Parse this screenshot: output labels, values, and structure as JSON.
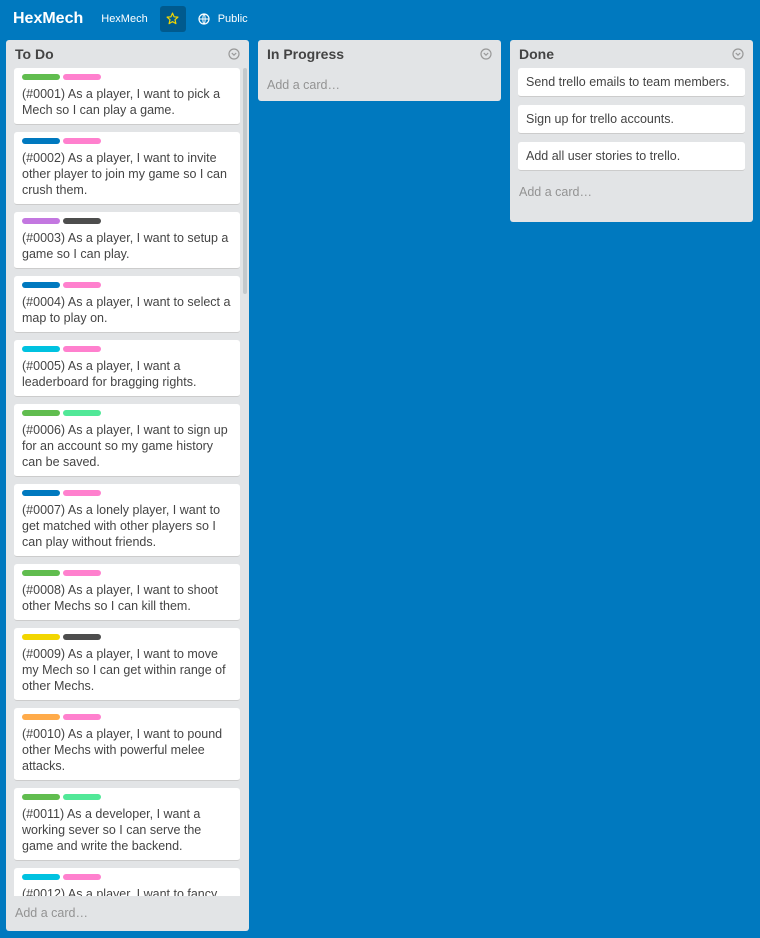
{
  "header": {
    "board_title": "HexMech",
    "org_name": "HexMech",
    "visibility": "Public",
    "icons": [
      "star-icon",
      "globe-icon"
    ]
  },
  "colors": {
    "background": "#0079bf",
    "list_bg": "#e2e4e6",
    "green": "#61bd4f",
    "pink": "#ff80ce",
    "blue": "#0079bf",
    "purple": "#c377e0",
    "black": "#4d4d4d",
    "sky": "#00c2e0",
    "lime": "#51e898",
    "yellow": "#f2d600",
    "orange": "#ffab4a"
  },
  "lists": {
    "todo": {
      "title": "To Do",
      "add_card": "Add a card…",
      "cards": [
        {
          "text": "(#0001) As a player, I want to pick a Mech so I can play a game.",
          "labels": [
            "green",
            "pink"
          ]
        },
        {
          "text": "(#0002) As a player, I want to invite other player to join my game so I can crush them.",
          "labels": [
            "blue",
            "pink"
          ]
        },
        {
          "text": "(#0003) As a player, I want to setup a game so I can play.",
          "labels": [
            "purple",
            "black"
          ]
        },
        {
          "text": "(#0004) As a player, I want to select a map to play on.",
          "labels": [
            "blue",
            "pink"
          ]
        },
        {
          "text": "(#0005) As a player, I want a leaderboard for bragging rights.",
          "labels": [
            "sky",
            "pink"
          ]
        },
        {
          "text": "(#0006) As a player, I want to sign up for an account so my game history can be saved.",
          "labels": [
            "green",
            "lime"
          ]
        },
        {
          "text": "(#0007) As a lonely player, I want to get matched with other players so I can play without friends.",
          "labels": [
            "blue",
            "pink"
          ]
        },
        {
          "text": "(#0008) As a player, I want to shoot other Mechs so I can kill them.",
          "labels": [
            "green",
            "pink"
          ]
        },
        {
          "text": "(#0009) As a player, I want to move my Mech so I can get within range of other Mechs.",
          "labels": [
            "yellow",
            "black"
          ]
        },
        {
          "text": "(#0010) As a player, I want to pound other Mechs with powerful melee attacks.",
          "labels": [
            "orange",
            "pink"
          ]
        },
        {
          "text": "(#0011) As a developer, I want a working sever so I can serve the game and write the backend.",
          "labels": [
            "green",
            "lime"
          ]
        },
        {
          "text": "(#0012) As a player, I want to fancy",
          "labels": [
            "sky",
            "pink"
          ]
        }
      ]
    },
    "inprogress": {
      "title": "In Progress",
      "add_card": "Add a card…",
      "cards": []
    },
    "done": {
      "title": "Done",
      "add_card": "Add a card…",
      "cards": [
        {
          "text": "Send trello emails to team members."
        },
        {
          "text": "Sign up for trello accounts."
        },
        {
          "text": "Add all user stories to trello."
        }
      ]
    }
  }
}
